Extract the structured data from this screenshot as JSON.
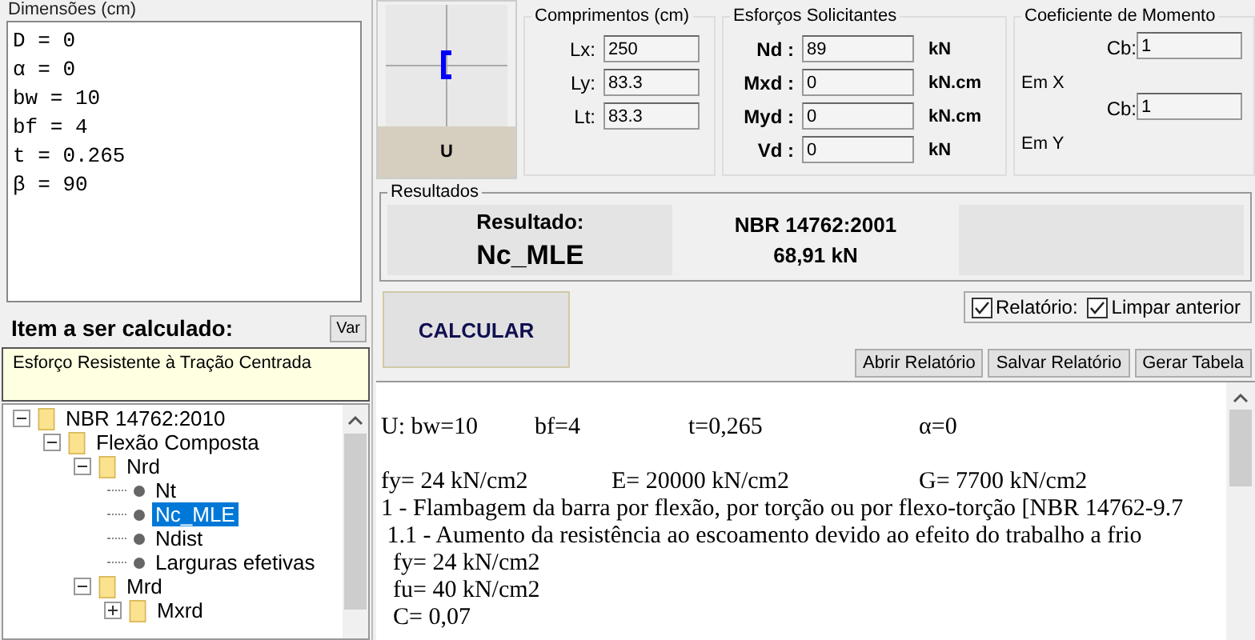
{
  "dimensions": {
    "label": "Dimensões (cm)",
    "lines": [
      "D = 0",
      "α = 0",
      "bw = 10",
      "bf = 4",
      "t = 0.265",
      "β = 90"
    ]
  },
  "item_panel": {
    "title": "Item a ser calculado:",
    "var_button": "Var",
    "description": "Esforço Resistente à Tração Centrada"
  },
  "tree": [
    {
      "label": "NBR 14762:2010",
      "kind": "folder",
      "expanded": true,
      "selected": false,
      "children": [
        {
          "label": "Flexão Composta",
          "kind": "folder",
          "expanded": true,
          "selected": false,
          "children": [
            {
              "label": "Nrd",
              "kind": "folder",
              "expanded": true,
              "selected": false,
              "children": [
                {
                  "label": "Nt",
                  "kind": "leaf",
                  "selected": false
                },
                {
                  "label": "Nc_MLE",
                  "kind": "leaf",
                  "selected": true
                },
                {
                  "label": "Ndist",
                  "kind": "leaf",
                  "selected": false
                },
                {
                  "label": "Larguras efetivas",
                  "kind": "leaf",
                  "selected": false
                }
              ]
            },
            {
              "label": "Mrd",
              "kind": "folder",
              "expanded": true,
              "selected": false,
              "children": [
                {
                  "label": "Mxrd",
                  "kind": "folder",
                  "expanded": false,
                  "selected": false
                }
              ]
            }
          ]
        }
      ]
    }
  ],
  "section": {
    "label": "U"
  },
  "lengths": {
    "title": "Comprimentos (cm)",
    "fields": [
      {
        "label": "Lx:",
        "value": "250"
      },
      {
        "label": "Ly:",
        "value": "83.3"
      },
      {
        "label": "Lt:",
        "value": "83.3"
      }
    ]
  },
  "loads": {
    "title": "Esforços Solicitantes",
    "fields": [
      {
        "label": "Nd :",
        "value": "89",
        "unit": "kN"
      },
      {
        "label": "Mxd :",
        "value": "0",
        "unit": "kN.cm"
      },
      {
        "label": "Myd :",
        "value": "0",
        "unit": "kN.cm"
      },
      {
        "label": "Vd :",
        "value": "0",
        "unit": "kN"
      }
    ]
  },
  "moment_coefficient": {
    "title": "Coeficiente de Momento",
    "rows": [
      {
        "axis": "Em X",
        "label": "Cb:",
        "value": "1"
      },
      {
        "axis": "Em Y",
        "label": "Cb:",
        "value": "1"
      }
    ]
  },
  "results": {
    "title": "Resultados",
    "heading": "Resultado:",
    "name": "Nc_MLE",
    "standard": "NBR 14762:2001",
    "value": "68,91 kN"
  },
  "calculate_button": "CALCULAR",
  "options": [
    {
      "label": "Relatório:",
      "checked": true
    },
    {
      "label": "Limpar anterior",
      "checked": true
    }
  ],
  "report_buttons": [
    "Abrir Relatório",
    "Salvar Relatório",
    "Gerar Tabela"
  ],
  "report": {
    "lines": [
      "U: bw=10\tbf=4\t\tt=0,265\t\tα=0",
      "fy= 24 kN/cm2\t\tE= 20000 kN/cm2\t\tG= 7700 kN/cm2",
      "1 - Flambagem da barra por flexão, por torção ou por flexo-torção [NBR 14762-9.7",
      " 1.1 - Aumento da resistência ao escoamento devido ao efeito do trabalho a frio",
      "  fy= 24 kN/cm2",
      "  fu= 40 kN/cm2",
      "  C= 0,07"
    ]
  }
}
